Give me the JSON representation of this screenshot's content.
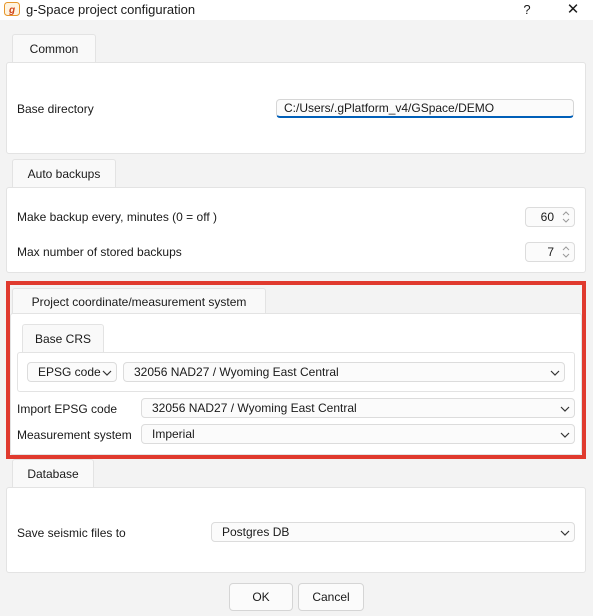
{
  "window": {
    "title": "g-Space project configuration",
    "help_label": "?",
    "close_label": "✕"
  },
  "common": {
    "tab_label": "Common",
    "base_directory_label": "Base directory",
    "base_directory_value": "C:/Users/.gPlatform_v4/GSpace/DEMO"
  },
  "auto_backups": {
    "tab_label": "Auto backups",
    "backup_interval_label": "Make backup every, minutes (0 = off )",
    "backup_interval_value": "60",
    "max_backups_label": "Max number of stored backups",
    "max_backups_value": "7"
  },
  "coordinate_system": {
    "tab_label": "Project coordinate/measurement system",
    "base_crs": {
      "tab_label": "Base CRS",
      "code_type": "EPSG code",
      "crs_value": "32056 NAD27 / Wyoming East Central"
    },
    "import_epsg_label": "Import EPSG code",
    "import_epsg_value": "32056 NAD27 / Wyoming East Central",
    "measurement_label": "Measurement system",
    "measurement_value": "Imperial"
  },
  "database": {
    "tab_label": "Database",
    "save_seismic_label": "Save seismic files to",
    "save_seismic_value": "Postgres DB"
  },
  "buttons": {
    "ok": "OK",
    "cancel": "Cancel"
  },
  "colors": {
    "highlight": "#e03a2e",
    "focus_underline": "#005fb8",
    "background": "#f3f3f3",
    "panel": "#ffffff"
  },
  "icons": {
    "app": "g-space-logo-icon",
    "spin": "spin-arrows-icon",
    "dropdown": "chevron-down-icon"
  }
}
